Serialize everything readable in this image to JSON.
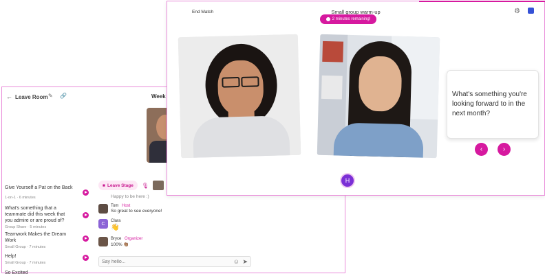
{
  "colors": {
    "accent": "#d6199f",
    "accent_light": "#fde7f5",
    "border": "#e98ad9"
  },
  "back_window": {
    "leave_room": "Leave Room",
    "week_title": "Week I",
    "sidebar_items": [
      {
        "title": "Give Yourself a Pat on the Back",
        "sub": "1-on-1 · 6 minutes"
      },
      {
        "title": "What's something that a teammate did this week that you admire or are proud of?",
        "sub": "Group Share · 5 minutes"
      },
      {
        "title": "Teamwork Makes the Dream Work",
        "sub": "Small Group · 7 minutes"
      },
      {
        "title": "Help!",
        "sub": "Small Group · 7 minutes"
      },
      {
        "title": "So Excited",
        "sub": ""
      }
    ],
    "leave_stage": "Leave Stage",
    "chat": {
      "happy": "Happy to be here :)",
      "messages": [
        {
          "name": "Tom",
          "role": "Host",
          "text": "So great to see everyone!"
        },
        {
          "name": "Clara",
          "role": "",
          "text": "👋",
          "initial": "C"
        },
        {
          "name": "Bryce",
          "role": "Organizer",
          "text": "100% 👏🏽"
        }
      ],
      "input_placeholder": "Say hello..."
    }
  },
  "front_window": {
    "end_match": "End Match",
    "title": "Small group warm-up",
    "timer": "2 minutes remaining!",
    "question": "What's something you're looking forward to in the next month?",
    "avatar_initial": "H"
  }
}
